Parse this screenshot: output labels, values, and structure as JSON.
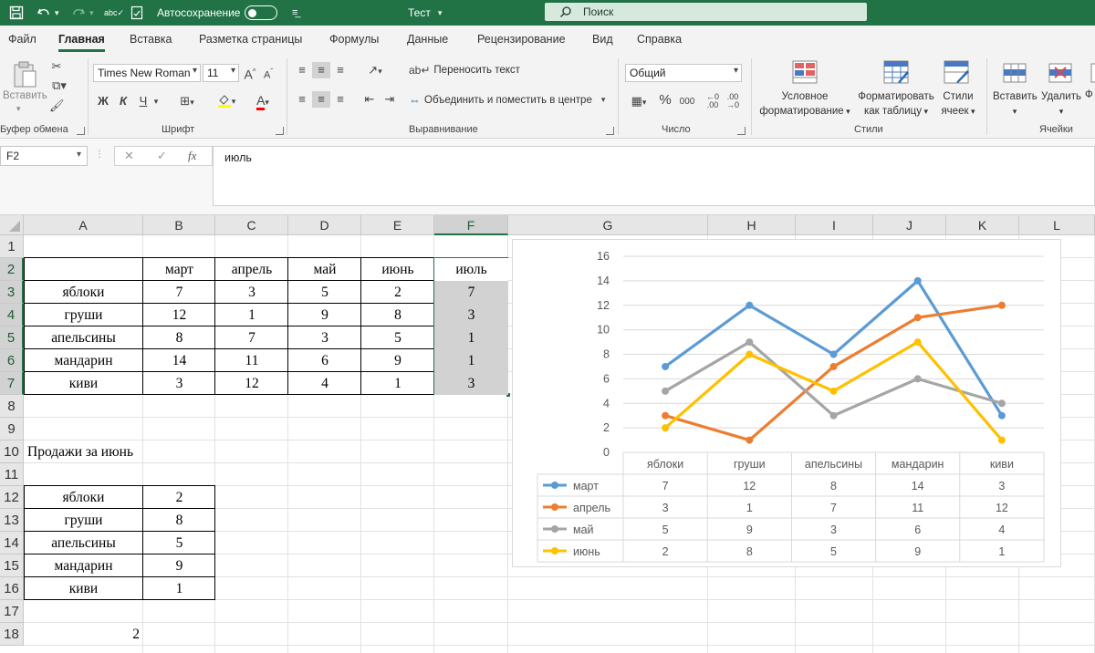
{
  "titlebar": {
    "autosave_label": "Автосохранение",
    "doc_title": "Тест",
    "search_placeholder": "Поиск",
    "bg_color": "#217346",
    "icons": [
      "undo-icon",
      "redo-icon",
      "spellcheck-icon",
      "save-icon",
      "customize-icon"
    ]
  },
  "ribbon_tabs": [
    {
      "label": "Файл",
      "active": false
    },
    {
      "label": "Главная",
      "active": true
    },
    {
      "label": "Вставка",
      "active": false
    },
    {
      "label": "Разметка страницы",
      "active": false
    },
    {
      "label": "Формулы",
      "active": false
    },
    {
      "label": "Данные",
      "active": false
    },
    {
      "label": "Рецензирование",
      "active": false
    },
    {
      "label": "Вид",
      "active": false
    },
    {
      "label": "Справка",
      "active": false
    }
  ],
  "ribbon": {
    "clipboard": {
      "paste_label": "Вставить",
      "group_label": "Буфер обмена"
    },
    "font": {
      "font_name": "Times New Roman",
      "font_size": "11",
      "bold": "Ж",
      "italic": "К",
      "underline": "Ч",
      "group_label": "Шрифт"
    },
    "alignment": {
      "wrap_text": "Переносить текст",
      "merge_center": "Объединить и поместить в центре",
      "group_label": "Выравнивание"
    },
    "number": {
      "format": "Общий",
      "percent": "%",
      "thousands": "000",
      "group_label": "Число"
    },
    "styles": {
      "conditional_line1": "Условное",
      "conditional_line2": "форматирование",
      "format_table_line1": "Форматировать",
      "format_table_line2": "как таблицу",
      "cell_styles_line1": "Стили",
      "cell_styles_line2": "ячеек",
      "group_label": "Стили"
    },
    "cells": {
      "insert": "Вставить",
      "delete": "Удалить",
      "format_partial": "Ф",
      "group_label": "Ячейки"
    }
  },
  "formula_bar": {
    "name_box": "F2",
    "fx": "fx",
    "content": "июль"
  },
  "columns": [
    "A",
    "B",
    "C",
    "D",
    "E",
    "F",
    "G",
    "H",
    "I",
    "J",
    "K",
    "L"
  ],
  "selected_column": "F",
  "rows": [
    "1",
    "2",
    "3",
    "4",
    "5",
    "6",
    "7",
    "8",
    "9",
    "10",
    "11",
    "12",
    "13",
    "14",
    "15",
    "16",
    "17",
    "18"
  ],
  "selected_rows": [
    "2",
    "3",
    "4",
    "5",
    "6",
    "7"
  ],
  "table1": {
    "headers": [
      "март",
      "апрель",
      "май",
      "июнь",
      "июль"
    ],
    "rows": [
      {
        "name": "яблоки",
        "values": [
          "7",
          "3",
          "5",
          "2",
          "7"
        ]
      },
      {
        "name": "груши",
        "values": [
          "12",
          "1",
          "9",
          "8",
          "3"
        ]
      },
      {
        "name": "апельсины",
        "values": [
          "8",
          "7",
          "3",
          "5",
          "1"
        ]
      },
      {
        "name": "мандарин",
        "values": [
          "14",
          "11",
          "6",
          "9",
          "1"
        ]
      },
      {
        "name": "киви",
        "values": [
          "3",
          "12",
          "4",
          "1",
          "3"
        ]
      }
    ]
  },
  "sales_title": "Продажи за июнь",
  "table2": {
    "rows": [
      {
        "name": "яблоки",
        "value": "2"
      },
      {
        "name": "груши",
        "value": "8"
      },
      {
        "name": "апельсины",
        "value": "5"
      },
      {
        "name": "мандарин",
        "value": "9"
      },
      {
        "name": "киви",
        "value": "1"
      }
    ]
  },
  "cell_a18": "2",
  "chart_data": {
    "type": "line",
    "categories": [
      "яблоки",
      "груши",
      "апельсины",
      "мандарин",
      "киви"
    ],
    "series": [
      {
        "name": "март",
        "values": [
          7,
          12,
          8,
          14,
          3
        ],
        "color": "#5b9bd5"
      },
      {
        "name": "апрель",
        "values": [
          3,
          1,
          7,
          11,
          12
        ],
        "color": "#ed7d31"
      },
      {
        "name": "май",
        "values": [
          5,
          9,
          3,
          6,
          4
        ],
        "color": "#a5a5a5"
      },
      {
        "name": "июнь",
        "values": [
          2,
          8,
          5,
          9,
          1
        ],
        "color": "#ffc000"
      }
    ],
    "ylim": [
      0,
      16
    ],
    "yticks": [
      0,
      2,
      4,
      6,
      8,
      10,
      12,
      14,
      16
    ],
    "grid": true,
    "legend": "data-table-below"
  }
}
